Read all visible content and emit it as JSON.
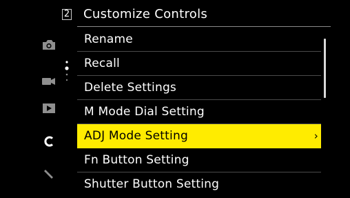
{
  "header": {
    "page_number": "2",
    "title": "Customize Controls"
  },
  "sidebar": {
    "tabs": [
      {
        "icon": "camera-icon",
        "active": false
      },
      {
        "icon": "video-camera-icon",
        "active": false
      },
      {
        "icon": "playback-icon",
        "active": false
      },
      {
        "icon": "custom-c-icon",
        "active": true
      },
      {
        "icon": "wrench-icon",
        "active": false
      }
    ]
  },
  "menu": {
    "items": [
      {
        "label": "Rename"
      },
      {
        "label": "Recall"
      },
      {
        "label": "Delete Settings"
      },
      {
        "label": "M Mode Dial Setting"
      },
      {
        "label": "ADJ Mode Setting",
        "selected": true,
        "chevron": "›"
      },
      {
        "label": "Fn Button Setting"
      },
      {
        "label": "Shutter Button Setting"
      }
    ]
  },
  "colors": {
    "highlight": "#ffec00",
    "background": "#000000",
    "text": "#ffffff",
    "inactive_icon": "#8f8f8f"
  }
}
